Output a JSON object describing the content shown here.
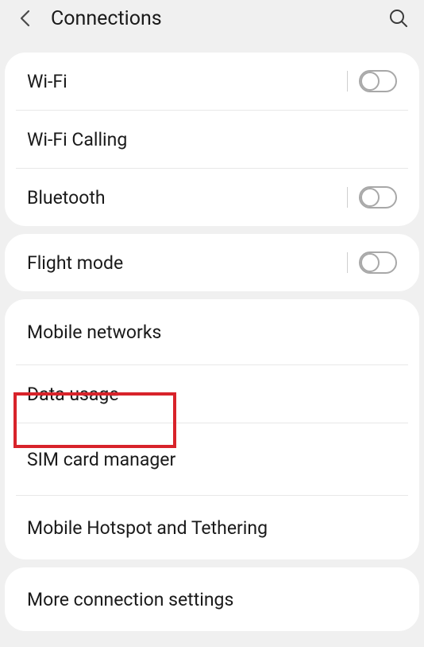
{
  "header": {
    "title": "Connections"
  },
  "group1": {
    "wifi": "Wi-Fi",
    "wifiCalling": "Wi-Fi Calling",
    "bluetooth": "Bluetooth"
  },
  "group2": {
    "flightMode": "Flight mode"
  },
  "group3": {
    "mobileNetworks": "Mobile networks",
    "dataUsage": "Data usage",
    "simCardManager": "SIM card manager",
    "hotspot": "Mobile Hotspot and Tethering"
  },
  "group4": {
    "moreConnSettings": "More connection settings"
  }
}
